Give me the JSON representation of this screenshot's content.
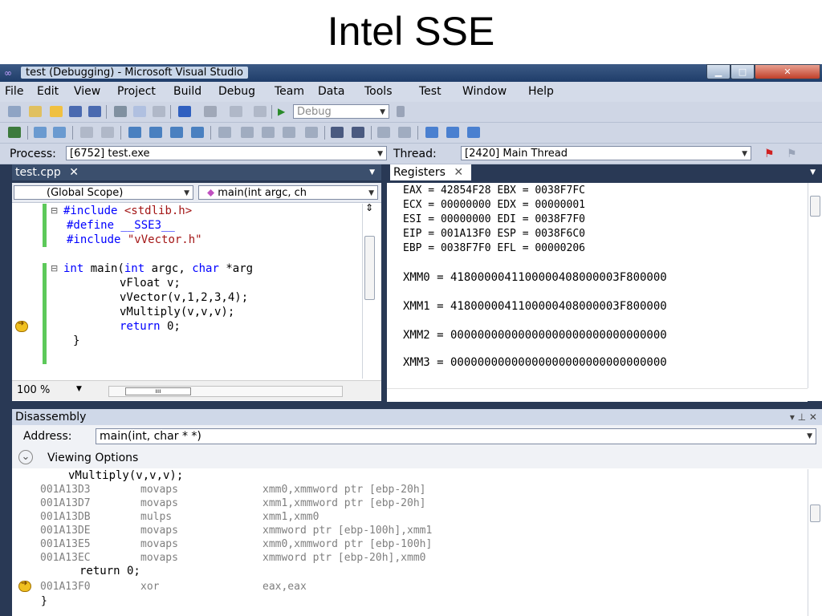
{
  "slide_title": "Intel SSE",
  "window": {
    "title": "test (Debugging) - Microsoft Visual Studio",
    "logo_icon": "infinity-logo-icon",
    "controls": [
      "minimize-icon",
      "maximize-icon",
      "close-icon"
    ]
  },
  "menu": [
    "File",
    "Edit",
    "View",
    "Project",
    "Build",
    "Debug",
    "Team",
    "Data",
    "Tools",
    "Test",
    "Window",
    "Help"
  ],
  "toolbar": {
    "config": "Debug",
    "process_label": "Process:",
    "process_value": "[6752] test.exe",
    "thread_label": "Thread:",
    "thread_value": "[2420] Main Thread"
  },
  "editor": {
    "tab": "test.cpp",
    "scope": "(Global Scope)",
    "function": "main(int argc, ch",
    "zoom": "100 %",
    "code": {
      "l1_kw": "#include",
      "l1_str": " <stdlib.h>",
      "l2": "#define __SSE3__",
      "l3_kw": "#include",
      "l3_str": " \"vVector.h\"",
      "l5_kw1": "int",
      "l5_mid": " main(",
      "l5_kw2": "int",
      "l5_mid2": " argc, ",
      "l5_kw3": "char",
      "l5_end": " *arg",
      "l6": "vFloat v;",
      "l7": "vVector(v,1,2,3,4);",
      "l8": "vMultiply(v,v,v);",
      "l9_kw": "return",
      "l9_end": " 0;",
      "l10": "}"
    }
  },
  "registers": {
    "tab": "Registers",
    "lines": [
      "EAX = 42854F28 EBX = 0038F7FC",
      "ECX = 00000000 EDX = 00000001",
      "ESI = 00000000 EDI = 0038F7F0",
      "EIP = 001A13F0 ESP = 0038F6C0",
      "EBP = 0038F7F0 EFL = 00000206"
    ],
    "xmm": [
      "XMM0 = 4180000041100000408000003F800000",
      "XMM1 = 4180000041100000408000003F800000",
      "XMM2 = 00000000000000000000000000000000",
      "XMM3 = 00000000000000000000000000000000"
    ]
  },
  "disassembly": {
    "title": "Disassembly",
    "address_label": "Address:",
    "address_value": "main(int, char * *)",
    "viewing_options": "Viewing Options",
    "pin_controls": "▾ ⊥ ✕",
    "source1": "vMultiply(v,v,v);",
    "rows": [
      {
        "addr": "001A13D3",
        "op": "movaps",
        "args": "xmm0,xmmword ptr [ebp-20h]"
      },
      {
        "addr": "001A13D7",
        "op": "movaps",
        "args": "xmm1,xmmword ptr [ebp-20h]"
      },
      {
        "addr": "001A13DB",
        "op": "mulps",
        "args": "xmm1,xmm0"
      },
      {
        "addr": "001A13DE",
        "op": "movaps",
        "args": "xmmword ptr [ebp-100h],xmm1"
      },
      {
        "addr": "001A13E5",
        "op": "movaps",
        "args": "xmm0,xmmword ptr [ebp-100h]"
      },
      {
        "addr": "001A13EC",
        "op": "movaps",
        "args": "xmmword ptr [ebp-20h],xmm0"
      }
    ],
    "source2": "return 0;",
    "current": {
      "addr": "001A13F0",
      "op": "xor",
      "args": "eax,eax"
    },
    "source3": "}"
  }
}
